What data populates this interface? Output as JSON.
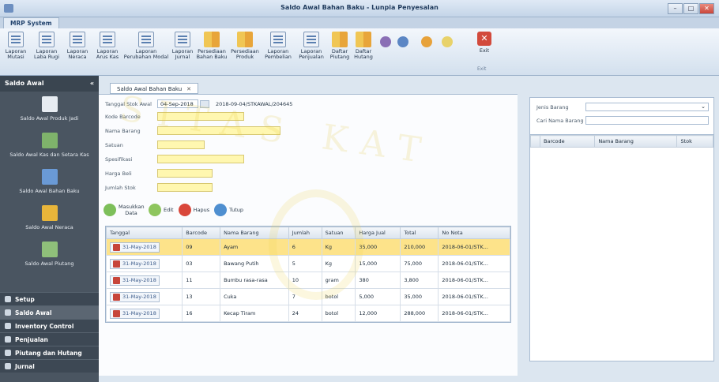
{
  "window": {
    "title": "Saldo Awal Bahan Baku - Lunpia Penyesalan",
    "min": "–",
    "max": "□",
    "close": "✕"
  },
  "app_tab": "MRP System",
  "ribbon": {
    "buttons": [
      {
        "line1": "Laporan",
        "line2": "Mutasi",
        "icon": "report-icon"
      },
      {
        "line1": "Laporan",
        "line2": "Laba Rugi",
        "icon": "report-icon"
      },
      {
        "line1": "Laporan",
        "line2": "Neraca",
        "icon": "report-icon"
      },
      {
        "line1": "Laporan",
        "line2": "Arus Kas",
        "icon": "report-icon"
      },
      {
        "line1": "Laporan",
        "line2": "Perubahan Modal",
        "icon": "report-icon"
      },
      {
        "line1": "Laporan",
        "line2": "Jurnal",
        "icon": "report-icon"
      },
      {
        "line1": "Persediaan",
        "line2": "Bahan Baku",
        "icon": "inventory-icon"
      },
      {
        "line1": "Persediaan",
        "line2": "Produk",
        "icon": "inventory-icon"
      },
      {
        "line1": "Laporan",
        "line2": "Pembelian",
        "icon": "report-icon"
      },
      {
        "line1": "Laporan",
        "line2": "Penjualan",
        "icon": "report-icon"
      },
      {
        "line1": "Daftar",
        "line2": "Piutang",
        "icon": "list-icon"
      },
      {
        "line1": "Daftar",
        "line2": "Hutang",
        "icon": "list-icon"
      }
    ],
    "exit": "Exit",
    "group_label": "Exit"
  },
  "sidebar": {
    "header": "Saldo Awal",
    "items": [
      {
        "label": "Saldo Awal Produk Jadi"
      },
      {
        "label": "Saldo Awal Kas dan Setara Kas"
      },
      {
        "label": "Saldo Awal Bahan Baku"
      },
      {
        "label": "Saldo Awal Neraca"
      },
      {
        "label": "Saldo Awal Piutang"
      }
    ],
    "sections": [
      "Setup",
      "Saldo Awal",
      "Inventory Control",
      "Penjualan",
      "Piutang dan Hutang",
      "Jurnal"
    ]
  },
  "doc_tab": "Saldo Awal Bahan Baku",
  "form": {
    "tanggal_label": "Tanggal Stok Awal",
    "tanggal_value": "04-Sep-2018",
    "nota_value": "2018-09-04/STKAWAL/204645",
    "kode_label": "Kode Barcode",
    "nama_label": "Nama Barang",
    "satuan_label": "Satuan",
    "spesifikasi_label": "Spesifikasi",
    "harga_label": "Harga Beli",
    "jumlah_label": "Jumlah Stok"
  },
  "actions": {
    "masukkan": "Masukkan Data",
    "edit": "Edit",
    "hapus": "Hapus",
    "tutup": "Tutup"
  },
  "table": {
    "headers": [
      "Tanggal",
      "Barcode",
      "Nama Barang",
      "Jumlah",
      "Satuan",
      "Harga Jual",
      "Total",
      "No Nota"
    ],
    "rows": [
      [
        "31-May-2018",
        "09",
        "Ayam",
        "6",
        "Kg",
        "35,000",
        "210,000",
        "2018-06-01/STK..."
      ],
      [
        "31-May-2018",
        "03",
        "Bawang Putih",
        "5",
        "Kg",
        "15,000",
        "75,000",
        "2018-06-01/STK..."
      ],
      [
        "31-May-2018",
        "11",
        "Bumbu rasa-rasa",
        "10",
        "gram",
        "380",
        "3,800",
        "2018-06-01/STK..."
      ],
      [
        "31-May-2018",
        "13",
        "Cuka",
        "7",
        "botol",
        "5,000",
        "35,000",
        "2018-06-01/STK..."
      ],
      [
        "31-May-2018",
        "16",
        "Kecap Tiram",
        "24",
        "botol",
        "12,000",
        "288,000",
        "2018-06-01/STK..."
      ]
    ]
  },
  "right": {
    "jenis_label": "Jenis Barang",
    "cari_label": "Cari Nama Barang",
    "headers": [
      "Barcode",
      "Nama Barang",
      "Stok"
    ]
  },
  "watermark": "SITAS KAT"
}
